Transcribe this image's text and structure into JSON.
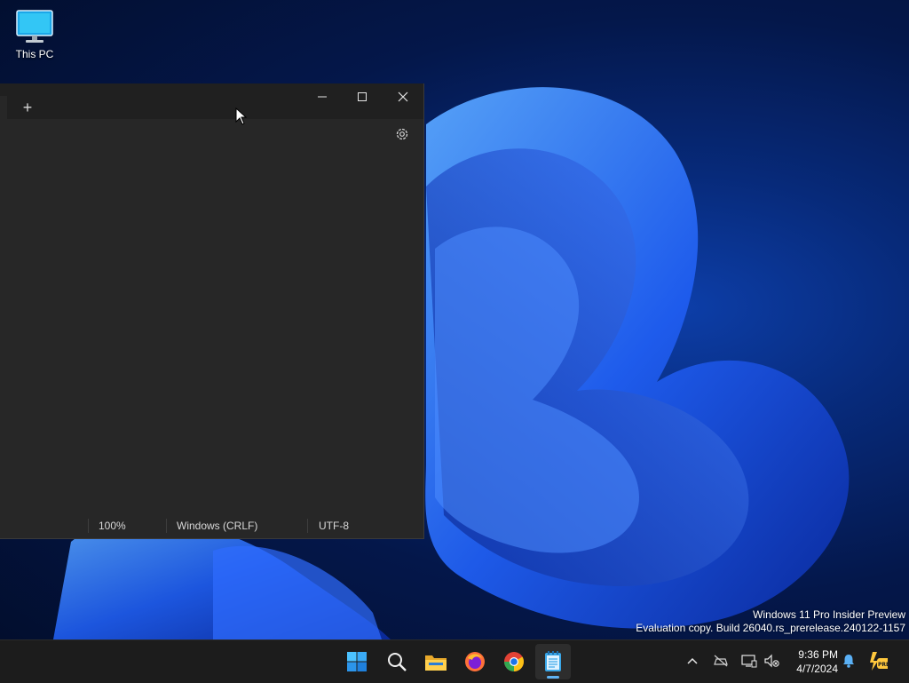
{
  "desktop": {
    "icons": [
      {
        "label": "This PC",
        "icon": "monitor-icon"
      }
    ]
  },
  "window": {
    "app": "Notepad",
    "new_tab_label": "+",
    "controls": {
      "minimize": "minimize-icon",
      "maximize": "maximize-icon",
      "close": "close-icon"
    },
    "settings_icon": "gear-icon",
    "editor_text": "",
    "status": {
      "zoom": "100%",
      "line_ending": "Windows (CRLF)",
      "encoding": "UTF-8"
    }
  },
  "watermark": {
    "line1": "Windows 11 Pro Insider Preview",
    "line2": "Evaluation copy. Build 26040.rs_prerelease.240122-1157"
  },
  "taskbar": {
    "apps": [
      {
        "name": "Start",
        "icon": "windows-start-icon"
      },
      {
        "name": "Search",
        "icon": "search-icon"
      },
      {
        "name": "File Explorer",
        "icon": "folder-icon"
      },
      {
        "name": "Firefox",
        "icon": "firefox-icon"
      },
      {
        "name": "Chrome",
        "icon": "chrome-icon"
      },
      {
        "name": "Notepad",
        "icon": "notepad-icon",
        "active": true
      }
    ],
    "tray": [
      "chevron-up-icon",
      "network-icon",
      "display-icon",
      "volume-muted-icon",
      "bell-icon",
      "pre-badge-icon"
    ],
    "time": "9:36 PM",
    "date": "4/7/2024"
  },
  "colors": {
    "accent": "#5fb2f2",
    "window_bg": "#272727",
    "titlebar_bg": "#202020",
    "taskbar_bg": "#1c1c1c"
  }
}
